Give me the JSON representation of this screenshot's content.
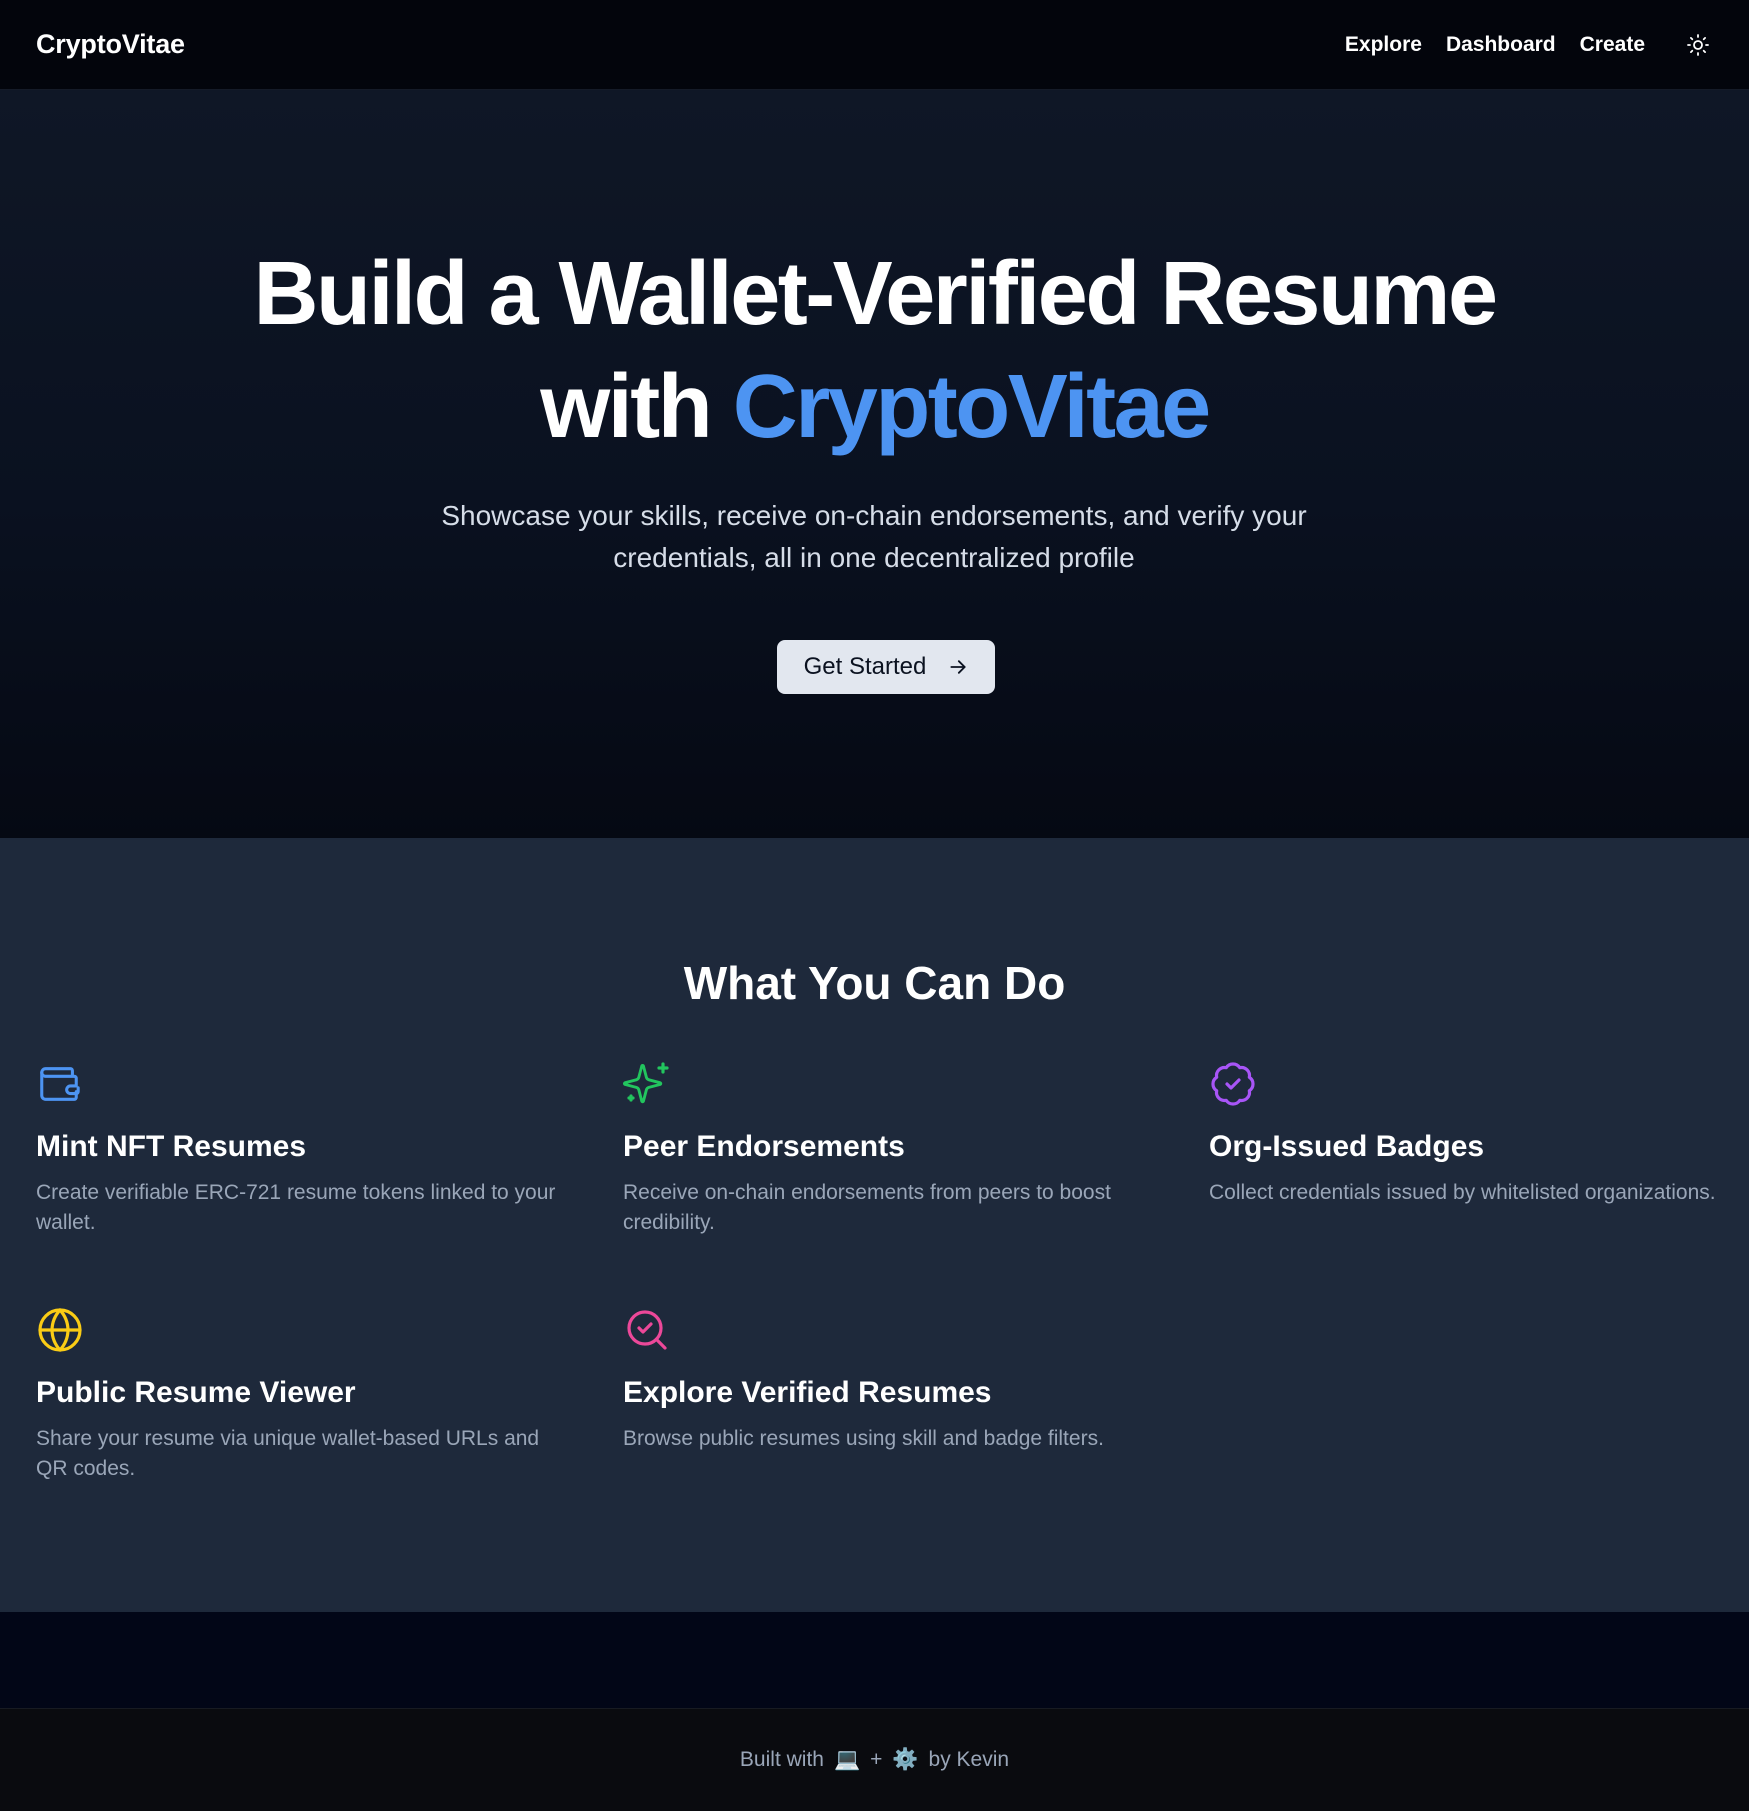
{
  "navbar": {
    "brand": "CryptoVitae",
    "links": [
      "Explore",
      "Dashboard",
      "Create"
    ],
    "theme_toggle_icon": "sun-icon"
  },
  "hero": {
    "title_line1": "Build a Wallet-Verified Resume",
    "title_line2_prefix": "with",
    "title_line2_accent": "CryptoVitae",
    "subtitle": "Showcase your skills, receive on-chain endorsements, and verify your credentials, all in one decentralized profile",
    "cta_label": "Get Started",
    "cta_icon": "arrow-right-icon",
    "accent_color": "#4d94f2"
  },
  "features": {
    "title": "What You Can Do",
    "items": [
      {
        "icon": "wallet-icon",
        "color": "#4d94f2",
        "title": "Mint NFT Resumes",
        "description": "Create verifiable ERC-721 resume tokens linked to your wallet."
      },
      {
        "icon": "sparkles-icon",
        "color": "#22c55e",
        "title": "Peer Endorsements",
        "description": "Receive on-chain endorsements from peers to boost credibility."
      },
      {
        "icon": "badge-check-icon",
        "color": "#a855f7",
        "title": "Org-Issued Badges",
        "description": "Collect credentials issued by whitelisted organizations."
      },
      {
        "icon": "globe-icon",
        "color": "#facc15",
        "title": "Public Resume Viewer",
        "description": "Share your resume via unique wallet-based URLs and QR codes."
      },
      {
        "icon": "search-check-icon",
        "color": "#ec4899",
        "title": "Explore Verified Resumes",
        "description": "Browse public resumes using skill and badge filters."
      }
    ]
  },
  "footer": {
    "prefix": "Built with",
    "glyph1": "💻",
    "plus": "+",
    "glyph2": "⚙️",
    "suffix": "by Kevin"
  }
}
